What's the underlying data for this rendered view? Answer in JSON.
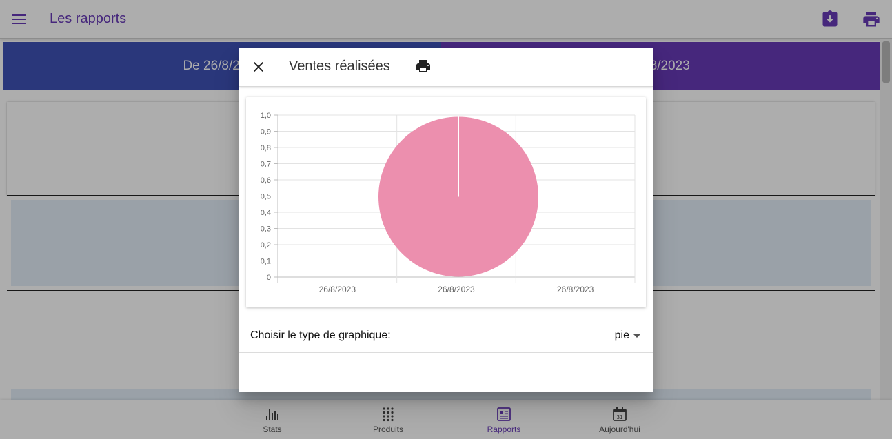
{
  "app": {
    "title": "Les rapports",
    "accent": "#673ab7",
    "toolbar_icons": [
      "download-icon",
      "print-icon"
    ]
  },
  "banner": {
    "left_text": "De 26/8/2023",
    "right_text": "26/8/2023",
    "left_color": "#3f51b5",
    "right_color": "#673ab7"
  },
  "bottom_nav": {
    "items": [
      {
        "label": "Stats",
        "icon": "bar-chart-icon"
      },
      {
        "label": "Produits",
        "icon": "grid-dots-icon"
      },
      {
        "label": "Rapports",
        "icon": "newspaper-icon",
        "active": true
      },
      {
        "label": "Aujourd'hui",
        "icon": "calendar-icon",
        "day": "31"
      }
    ]
  },
  "dialog": {
    "title": "Ventes réalisées",
    "chart_type_label": "Choisir le type de graphique:",
    "chart_type_value": "pie"
  },
  "chart_data": {
    "type": "pie",
    "title": "",
    "xlabel": "",
    "ylabel": "",
    "categories": [
      "26/8/2023",
      "26/8/2023",
      "26/8/2023"
    ],
    "values": [
      1
    ],
    "y_ticks": [
      "0",
      "0,1",
      "0,2",
      "0,3",
      "0,4",
      "0,5",
      "0,6",
      "0,7",
      "0,8",
      "0,9",
      "1,0"
    ],
    "ylim": [
      0,
      1
    ],
    "grid": true,
    "slice_color": "#ec8fae"
  }
}
